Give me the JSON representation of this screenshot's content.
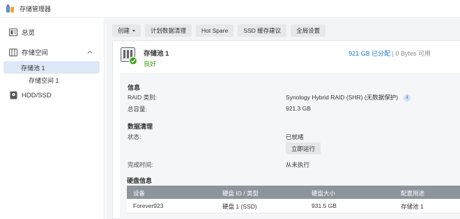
{
  "app": {
    "title": "存储管理器"
  },
  "sidebar": {
    "overview": "总览",
    "storage_space": "存储空间",
    "pool": "存储池 1",
    "volume": "存储空间 1",
    "hdd": "HDD/SSD"
  },
  "toolbar": {
    "create": "创建",
    "scrub_schedule": "计划数据清理",
    "hot_spare": "Hot Spare",
    "ssd_cache_advisor": "SSD 缓存建议",
    "global_settings": "全局设置"
  },
  "pool": {
    "name": "存储池 1",
    "status": "良好",
    "allocated": "921 GB 已分配",
    "separator": " | ",
    "available": "0 Bytes 可用"
  },
  "info": {
    "title": "信息",
    "raid_label": "RAID 类别:",
    "raid_value": "Synology Hybrid RAID (SHR) (无数据保护)",
    "info_icon": "i",
    "capacity_label": "总容量:",
    "capacity_value": "921.3 GB"
  },
  "scrub": {
    "title": "数据清理",
    "status_label": "状态:",
    "status_value": "已就绪",
    "run_button": "立即运行",
    "finish_label": "完成时间:",
    "finish_value": "从未执行"
  },
  "disks": {
    "title": "硬盘信息",
    "headers": [
      "设备",
      "硬盘 ID / 类型",
      "硬盘大小",
      "配置用途"
    ],
    "rows": [
      [
        "Forever923",
        "硬盘 1 (SSD)",
        "931.5 GB",
        "存储池 1"
      ]
    ]
  },
  "colors": {
    "accent": "#1f76c9",
    "healthy": "#38a313",
    "selected_bg": "#dde9f7",
    "table_header": "#8d949c"
  }
}
